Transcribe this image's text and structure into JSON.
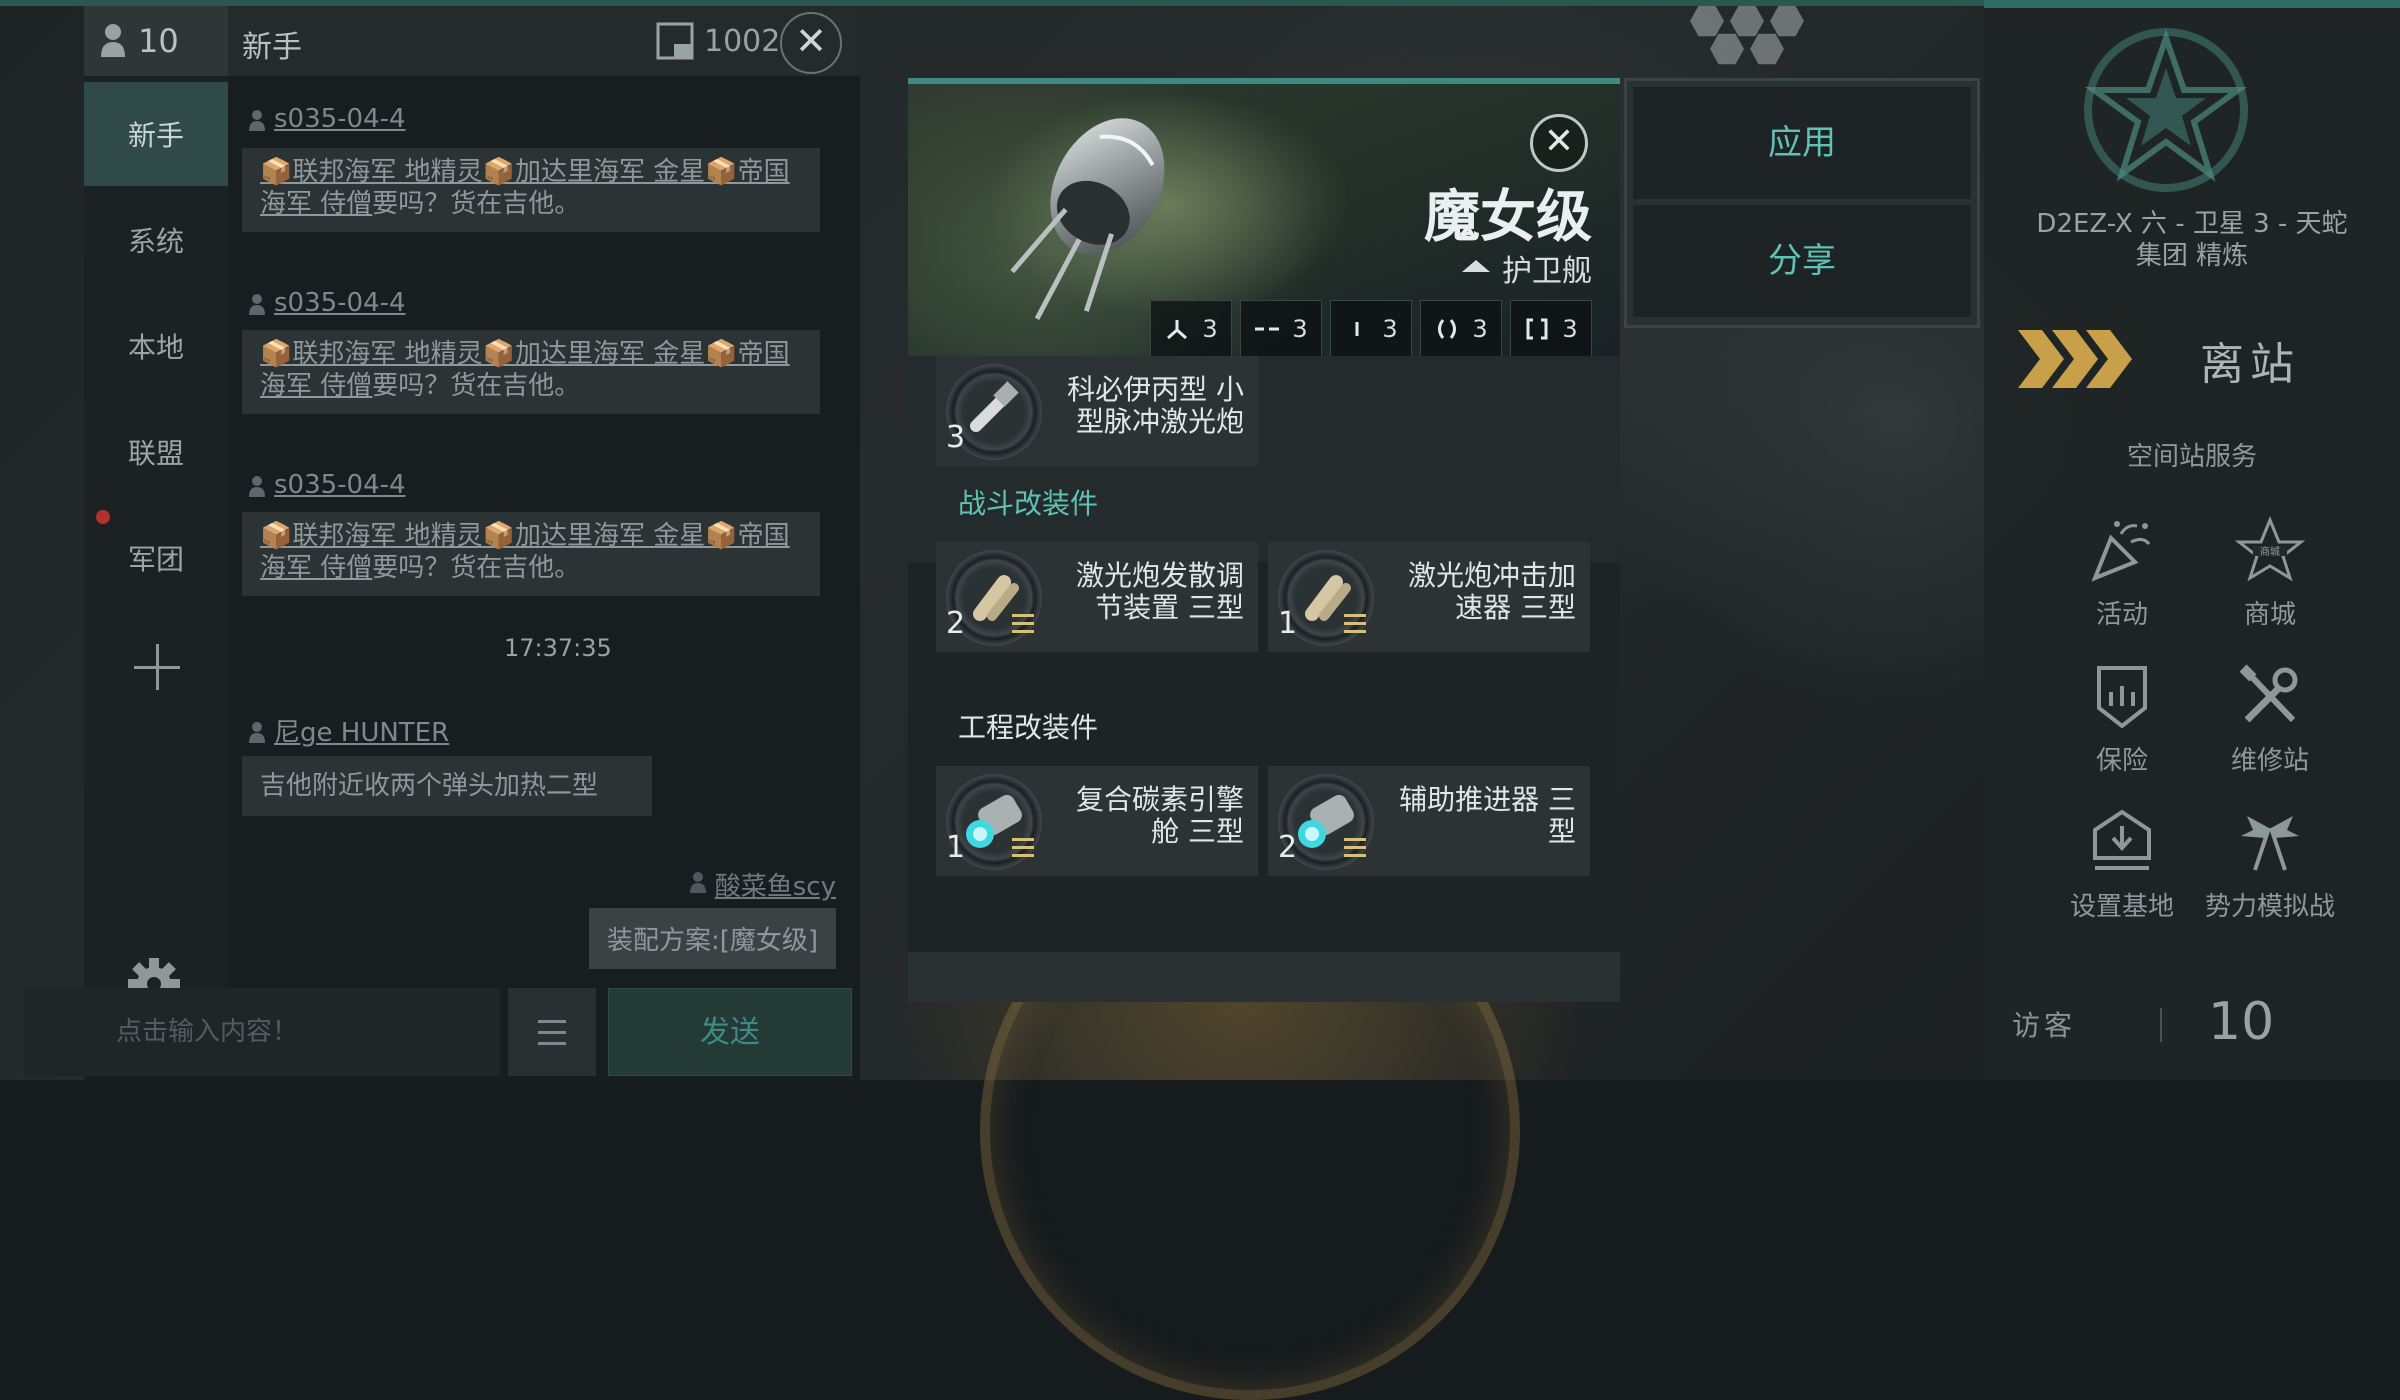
{
  "chat": {
    "member_count": "10",
    "channel_title": "新手",
    "window_count": "1002",
    "channels": [
      {
        "label": "新手",
        "active": true
      },
      {
        "label": "系统",
        "active": false
      },
      {
        "label": "本地",
        "active": false
      },
      {
        "label": "联盟",
        "active": false
      },
      {
        "label": "军团",
        "active": false
      }
    ],
    "messages": [
      {
        "sender": "s035-04-4",
        "text_pre": "📦联邦海军 地精灵📦加达里海军 金星📦帝国海军 侍僧",
        "text_post": "要吗？货在吉他。"
      },
      {
        "sender": "s035-04-4",
        "text_pre": "📦联邦海军 地精灵📦加达里海军 金星📦帝国海军 侍僧",
        "text_post": "要吗？货在吉他。"
      },
      {
        "sender": "s035-04-4",
        "text_pre": "📦联邦海军 地精灵📦加达里海军 金星📦帝国海军 侍僧",
        "text_post": "要吗？货在吉他。"
      }
    ],
    "timestamp": "17:37:35",
    "message4": {
      "sender": "尼ge HUNTER",
      "text": "吉他附近收两个弹头加热二型"
    },
    "self_message": {
      "sender": "酸菜鱼scy",
      "text": "装配方案:[魔女级]"
    },
    "input_placeholder": "点击输入内容！",
    "send_label": "发送"
  },
  "dialog": {
    "ship_name": "魔女级",
    "ship_class": "护卫舰",
    "slots": [
      "3",
      "3",
      "3",
      "3",
      "3"
    ],
    "weapon": {
      "qty": "3",
      "name": "科必伊丙型 小型脉冲激光炮"
    },
    "combat_section": "战斗改装件",
    "combat_mods": [
      {
        "qty": "2",
        "name": "激光炮发散调节装置 三型"
      },
      {
        "qty": "1",
        "name": "激光炮冲击加速器 三型"
      }
    ],
    "engineering_section": "工程改装件",
    "engineering_mods": [
      {
        "qty": "1",
        "name": "复合碳素引擎舱 三型"
      },
      {
        "qty": "2",
        "name": "辅助推进器 三型"
      }
    ],
    "close_symbol": "✕"
  },
  "actions": {
    "apply": "应用",
    "share": "分享"
  },
  "station": {
    "location_line1": "D2EZ-X 六 - 卫星 3 - 天蛇",
    "location_line2": "集团 精炼",
    "undock": "离站",
    "services_title": "空间站服务",
    "services": [
      {
        "label": "活动",
        "icon": "party-popper-icon"
      },
      {
        "label": "商城",
        "icon": "mall-star-icon"
      },
      {
        "label": "保险",
        "icon": "insurance-icon"
      },
      {
        "label": "维修站",
        "icon": "repair-tools-icon"
      },
      {
        "label": "设置基地",
        "icon": "set-base-icon"
      },
      {
        "label": "势力模拟战",
        "icon": "faction-battle-icon"
      }
    ],
    "visitor_label": "访客",
    "visitor_count": "10"
  },
  "colors": {
    "accent_teal": "#5fc2b4",
    "tier_gold": "#d8bf7a",
    "alert_red": "#b3302d"
  }
}
